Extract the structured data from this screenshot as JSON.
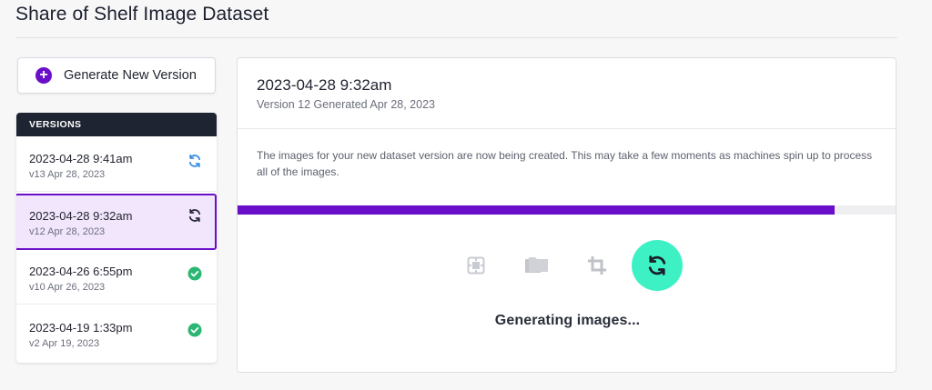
{
  "page": {
    "title": "Share of Shelf Image Dataset"
  },
  "generate_button": {
    "label": "Generate New Version",
    "icon": "plus-circle-icon",
    "color": "#6a0ec9"
  },
  "versions": {
    "header": "VERSIONS",
    "items": [
      {
        "date": "2023-04-28 9:41am",
        "sub": "v13 Apr 28, 2023",
        "status": "generating",
        "selected": false
      },
      {
        "date": "2023-04-28 9:32am",
        "sub": "v12 Apr 28, 2023",
        "status": "generating",
        "selected": true
      },
      {
        "date": "2023-04-26 6:55pm",
        "sub": "v10 Apr 26, 2023",
        "status": "complete",
        "selected": false
      },
      {
        "date": "2023-04-19 1:33pm",
        "sub": "v2 Apr 19, 2023",
        "status": "complete",
        "selected": false
      }
    ]
  },
  "detail": {
    "title": "2023-04-28 9:32am",
    "subtitle": "Version 12 Generated Apr 28, 2023",
    "description": "The images for your new dataset version are now being created. This may take a few moments as machines spin up to process all of the images.",
    "progress": 0.905,
    "steps": [
      {
        "icon": "preprocessing-icon",
        "active": false
      },
      {
        "icon": "folders-icon",
        "active": false
      },
      {
        "icon": "crop-icon",
        "active": false
      },
      {
        "icon": "sync-icon",
        "active": true
      }
    ],
    "status_text": "Generating images..."
  },
  "colors": {
    "accent": "#6a0ec9",
    "active_step": "#3ef1c4",
    "complete": "#2bb673",
    "generating_blue": "#3b8fe0",
    "header_dark": "#1f2433"
  }
}
